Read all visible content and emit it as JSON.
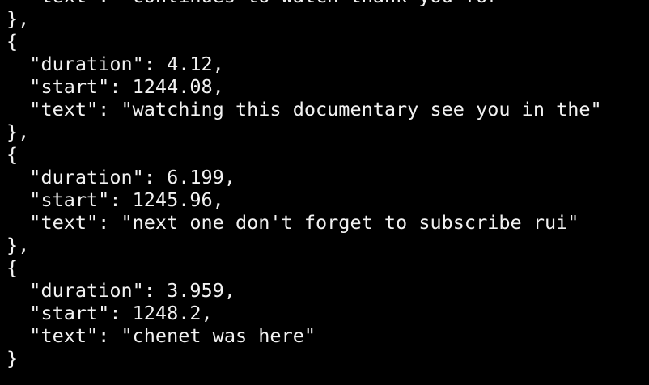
{
  "terminal": {
    "lines": [
      "  \"text\": \"continues to watch thank you for\"",
      "},",
      "{",
      "  \"duration\": 4.12,",
      "  \"start\": 1244.08,",
      "  \"text\": \"watching this documentary see you in the\"",
      "},",
      "{",
      "  \"duration\": 6.199,",
      "  \"start\": 1245.96,",
      "  \"text\": \"next one don't forget to subscribe rui\"",
      "},",
      "{",
      "  \"duration\": 3.959,",
      "  \"start\": 1248.2,",
      "  \"text\": \"chenet was here\"",
      "}"
    ]
  }
}
